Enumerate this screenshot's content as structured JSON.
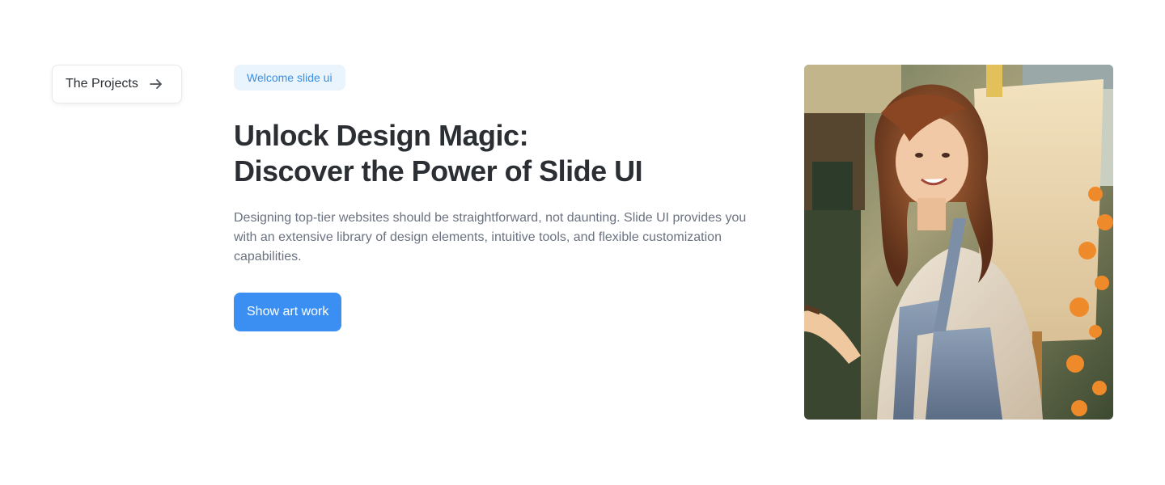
{
  "projects_button": {
    "label": "The Projects",
    "icon": "arrow-right-icon"
  },
  "hero": {
    "badge": "Welcome slide ui",
    "headline_line1": "Unlock Design Magic:",
    "headline_line2": "Discover the Power of Slide UI",
    "description": "Designing top-tier websites should be straightforward, not daunting. Slide UI provides you with an extensive library of design elements, intuitive tools, and flexible customization capabilities.",
    "cta_label": "Show art work"
  },
  "image": {
    "subject": "painter-portrait-image"
  },
  "colors": {
    "accent": "#3b8ff2",
    "badge_bg": "#eaf4fd",
    "badge_text": "#3a8fe4",
    "heading": "#2b2f33",
    "body_text": "#6b7280"
  }
}
